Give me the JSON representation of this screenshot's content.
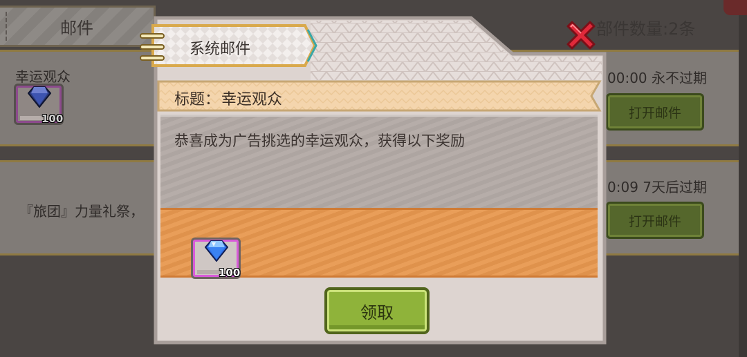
{
  "background": {
    "tab_label": "邮件",
    "mail_count": "部件数量:2条",
    "mails": [
      {
        "title": "幸运观众",
        "date": "00:00 永不过期",
        "button": "打开邮件",
        "reward_qty": "100"
      },
      {
        "title": "『旅团』力量礼祭，",
        "date": "0:09 7天后过期",
        "button": "打开邮件"
      }
    ]
  },
  "dialog": {
    "tab_label": "系统邮件",
    "title_prefix": "标题：",
    "title": "幸运观众",
    "content": "恭喜成为广告挑选的幸运观众，获得以下奖励",
    "rewards": [
      {
        "icon": "blue-gem-icon",
        "qty": "100"
      }
    ],
    "claim_label": "领取"
  },
  "colors": {
    "dialog_bg": "#ddd4d0",
    "banner": "#f4d5ad",
    "reward_bg": "#e8984f",
    "claim": "#8fb33a",
    "close": "#e0293a"
  }
}
